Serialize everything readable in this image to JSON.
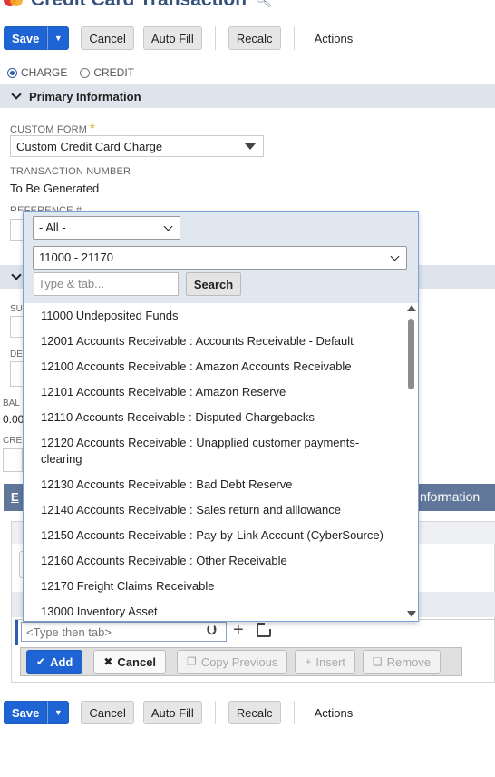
{
  "page": {
    "title": "Credit Card Transaction"
  },
  "toolbar": {
    "save": "Save",
    "cancel": "Cancel",
    "auto_fill": "Auto Fill",
    "recalc": "Recalc",
    "actions": "Actions"
  },
  "type_radio": {
    "charge": "CHARGE",
    "credit": "CREDIT",
    "selected": "CHARGE"
  },
  "primary_section": {
    "title": "Primary Information",
    "custom_form_label": "CUSTOM FORM",
    "custom_form_value": "Custom Credit Card Charge",
    "transaction_number_label": "TRANSACTION NUMBER",
    "transaction_number_value": "To Be Generated",
    "reference_label": "REFERENCE #"
  },
  "hidden_stubs": {
    "su": "SU",
    "de": "DE",
    "bal": "BAL",
    "bal_value": "0.00",
    "cre": "CRE",
    "tab_left": "E",
    "tab_right": "nformation"
  },
  "popup": {
    "filter_select": "- All -",
    "range_select": "11000 - 21170",
    "search_placeholder": "Type & tab...",
    "search_button": "Search",
    "items": [
      "11000 Undeposited Funds",
      "12001 Accounts Receivable : Accounts Receivable - Default",
      "12100 Accounts Receivable : Amazon Accounts Receivable",
      "12101 Accounts Receivable : Amazon Reserve",
      "12110 Accounts Receivable : Disputed Chargebacks",
      "12120 Accounts Receivable : Unapplied customer payments-clearing",
      "12130 Accounts Receivable : Bad Debt Reserve",
      "12140 Accounts Receivable : Sales return and alllowance",
      "12150 Accounts Receivable : Pay-by-Link Account (CyberSource)",
      "12160 Accounts Receivable : Other Receivable",
      "12170 Freight Claims Receivable",
      "13000 Inventory Asset"
    ]
  },
  "line_entry": {
    "placeholder": "<Type then tab>",
    "add": "Add",
    "cancel": "Cancel",
    "copy_previous": "Copy Previous",
    "insert": "Insert",
    "remove": "Remove"
  },
  "icons": {
    "search": "magnifier",
    "chevron": "chevron-down",
    "plus": "plus",
    "open": "external-link"
  },
  "colors": {
    "primary_button": "#1e64d4",
    "title": "#36527a",
    "section_bar": "#dfe4ec",
    "tab_header": "#607799"
  }
}
